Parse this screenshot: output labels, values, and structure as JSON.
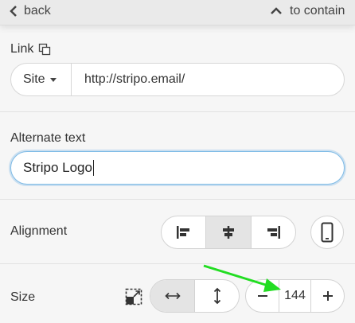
{
  "topbar": {
    "back_label": "back",
    "to_container_label": "to contain"
  },
  "link": {
    "label": "Link",
    "type_selected": "Site",
    "url_value": "http://stripo.email/"
  },
  "alt_text": {
    "label": "Alternate text",
    "value": "Stripo Logo"
  },
  "alignment": {
    "label": "Alignment",
    "options": [
      "left",
      "center",
      "right"
    ],
    "selected": "center"
  },
  "size": {
    "label": "Size",
    "direction_selected": "horizontal",
    "value": "144"
  },
  "colors": {
    "focus_border": "#7fbbe6",
    "annotation_arrow": "#22dd22"
  }
}
